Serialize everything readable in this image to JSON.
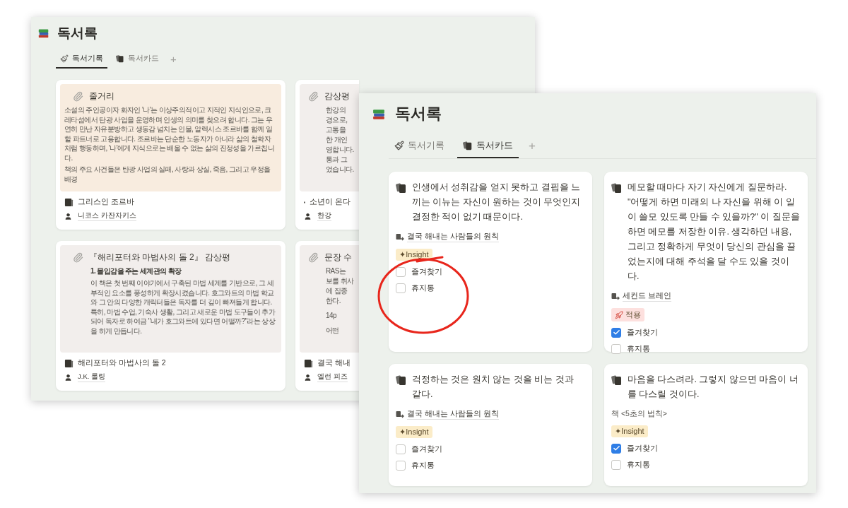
{
  "back_window": {
    "title": "독서록",
    "tabs": [
      {
        "kind": "brush",
        "label": "독서기록",
        "selected": true
      },
      {
        "kind": "cards",
        "label": "독서카드",
        "selected": false
      }
    ],
    "add_tab": "+",
    "cards": [
      {
        "color": "#f8ecdf",
        "preview_title": "줄거리",
        "preview_paragraphs": [
          "소설의 주인공이자 화자인 '나'는 이상주의적이고 지적인 지식인으로, 크레타섬에서 탄광 사업을 운영하며 인생의 의미를 찾으려 합니다. 그는 우연히 만난 자유분방하고 생동감 넘치는 인물, 알렉시스 조르바를 함께 일할 파트너로 고용합니다. 조르바는 단순한 노동자가 아니라 삶의 철학자처럼 행동하며, '나'에게 지식으로는 배울 수 없는 삶의 진정성을 가르칩니다.",
          "책의 주요 사건들은 탄광 사업의 실패, 사랑과 상실, 죽음, 그리고 우정을 배경"
        ],
        "book": "그리스인 조르바",
        "authors": [
          "니코스 카잔차키스"
        ]
      },
      {
        "color": "#f2eeec",
        "preview_title": "감상평",
        "preview_blocks": [
          [
            "한강의",
            "경으로,",
            "고통을",
            "한 개인",
            "영합니다.",
            "통과 그",
            "었습니다."
          ]
        ],
        "book": "소년이 온다",
        "authors": [
          "한강"
        ]
      },
      {
        "color": "#f2eeec",
        "preview_title": "『해리포터와 마법사의 돌 2』 감상평",
        "preview_heading": "1. 몰입감을 주는 세계관의 확장",
        "preview_paragraphs": [
          "이 책은 첫 번째 이야기에서 구축된 마법 세계를 기반으로, 그 세부적인 요소를 풍성하게 확장시켰습니다. 호그와트의 마법 학교와 그 안의 다양한 캐릭터들은 독자를 더 깊이 빠져들게 합니다. 특히, 마법 수업, 기숙사 생활, 그리고 새로운 마법 도구들이 추가되어 독자로 하여금 \"내가 호그와트에 있다면 어떨까?\"라는 상상을 하게 만듭니다."
        ],
        "book": "해리포터와 마법사의 돌 2",
        "authors": [
          "J.K. 롤링"
        ]
      },
      {
        "color": "#f2eeec",
        "preview_title": "문장 수",
        "preview_blocks": [
          [
            "RAS는",
            "보를 취사",
            "에 집중",
            "한다."
          ],
          [
            "14p"
          ],
          [
            "어떤"
          ]
        ],
        "book": "결국 해내",
        "authors": [
          "엘런 피즈"
        ]
      }
    ]
  },
  "front_window": {
    "title": "독서록",
    "tabs": [
      {
        "kind": "brush",
        "label": "독서기록",
        "selected": false
      },
      {
        "kind": "cards",
        "label": "독서카드",
        "selected": true
      }
    ],
    "add_tab": "+",
    "cards": [
      {
        "quote": "인생에서 성취감을 얻지 못하고 결핍을 느끼는 이뉴는 자신이 원하는 것이 무엇인지 결정한 적이 없기 때문이다.",
        "source": {
          "kind": "link",
          "text": "결국 해내는 사람들의 원칙"
        },
        "tag": {
          "kind": "insight",
          "label": "✦Insight",
          "color": "#fbecc8"
        },
        "checks": [
          {
            "label": "즐겨찾기",
            "checked": false
          },
          {
            "label": "휴지통",
            "checked": false
          }
        ]
      },
      {
        "quote": "메모할 때마다 자기 자신에게 질문하라. \"어떻게 하면 미래의 나 자신을 위해 이 일이 쓸모 있도록 만들 수 있을까?\" 이 질문을 하면 메모를 저장한 이유. 생각하던 내용, 그리고 정확하게 무엇이 당신의 관심을 끌었는지에 대해 주석을 달 수도 있을 것이다.",
        "source": {
          "kind": "link",
          "text": "세컨드 브레인"
        },
        "tag": {
          "kind": "apply",
          "label": "적용",
          "color": "#fde0de"
        },
        "checks": [
          {
            "label": "즐겨찾기",
            "checked": true
          },
          {
            "label": "휴지통",
            "checked": false
          }
        ]
      },
      {
        "quote": "걱정하는 것은 원치 않는 것을 비는 것과 같다.",
        "source": {
          "kind": "link",
          "text": "결국 해내는 사람들의 원칙"
        },
        "tag": {
          "kind": "insight",
          "label": "✦Insight",
          "color": "#fbecc8"
        },
        "checks": [
          {
            "label": "즐겨찾기",
            "checked": false
          },
          {
            "label": "휴지통",
            "checked": false
          }
        ]
      },
      {
        "quote": "마음을 다스려라. 그렇지 않으면 마음이 너를 다스릴 것이다.",
        "source": {
          "kind": "plain",
          "text": "책 <5초의 법칙>"
        },
        "tag": {
          "kind": "insight",
          "label": "✦Insight",
          "color": "#fbecc8"
        },
        "checks": [
          {
            "label": "즐겨찾기",
            "checked": true
          },
          {
            "label": "휴지통",
            "checked": false
          }
        ]
      }
    ]
  }
}
